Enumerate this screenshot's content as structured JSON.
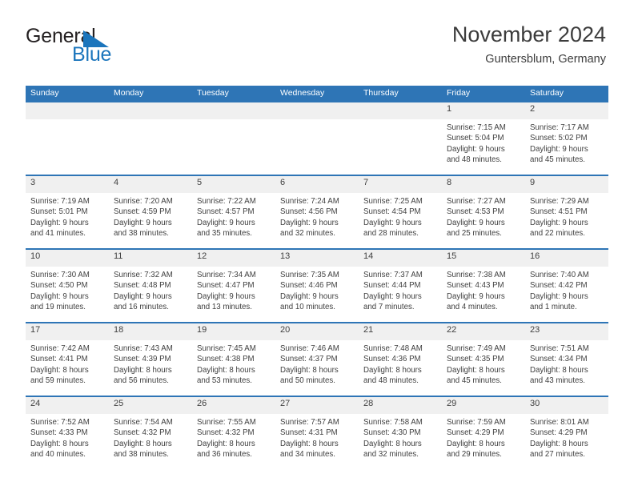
{
  "brand": {
    "word_one": "General",
    "word_two": "Blue",
    "triangle_icon": "triangle-icon",
    "accent_color": "#1b75bc"
  },
  "header": {
    "title": "November 2024",
    "subtitle": "Guntersblum, Germany"
  },
  "calendar": {
    "header_bg": "#2e75b6",
    "daynum_bg": "#f0f0f0",
    "weekdays": [
      "Sunday",
      "Monday",
      "Tuesday",
      "Wednesday",
      "Thursday",
      "Friday",
      "Saturday"
    ],
    "weeks": [
      [
        {
          "day": "",
          "lines": []
        },
        {
          "day": "",
          "lines": []
        },
        {
          "day": "",
          "lines": []
        },
        {
          "day": "",
          "lines": []
        },
        {
          "day": "",
          "lines": []
        },
        {
          "day": "1",
          "lines": [
            "Sunrise: 7:15 AM",
            "Sunset: 5:04 PM",
            "Daylight: 9 hours",
            "and 48 minutes."
          ]
        },
        {
          "day": "2",
          "lines": [
            "Sunrise: 7:17 AM",
            "Sunset: 5:02 PM",
            "Daylight: 9 hours",
            "and 45 minutes."
          ]
        }
      ],
      [
        {
          "day": "3",
          "lines": [
            "Sunrise: 7:19 AM",
            "Sunset: 5:01 PM",
            "Daylight: 9 hours",
            "and 41 minutes."
          ]
        },
        {
          "day": "4",
          "lines": [
            "Sunrise: 7:20 AM",
            "Sunset: 4:59 PM",
            "Daylight: 9 hours",
            "and 38 minutes."
          ]
        },
        {
          "day": "5",
          "lines": [
            "Sunrise: 7:22 AM",
            "Sunset: 4:57 PM",
            "Daylight: 9 hours",
            "and 35 minutes."
          ]
        },
        {
          "day": "6",
          "lines": [
            "Sunrise: 7:24 AM",
            "Sunset: 4:56 PM",
            "Daylight: 9 hours",
            "and 32 minutes."
          ]
        },
        {
          "day": "7",
          "lines": [
            "Sunrise: 7:25 AM",
            "Sunset: 4:54 PM",
            "Daylight: 9 hours",
            "and 28 minutes."
          ]
        },
        {
          "day": "8",
          "lines": [
            "Sunrise: 7:27 AM",
            "Sunset: 4:53 PM",
            "Daylight: 9 hours",
            "and 25 minutes."
          ]
        },
        {
          "day": "9",
          "lines": [
            "Sunrise: 7:29 AM",
            "Sunset: 4:51 PM",
            "Daylight: 9 hours",
            "and 22 minutes."
          ]
        }
      ],
      [
        {
          "day": "10",
          "lines": [
            "Sunrise: 7:30 AM",
            "Sunset: 4:50 PM",
            "Daylight: 9 hours",
            "and 19 minutes."
          ]
        },
        {
          "day": "11",
          "lines": [
            "Sunrise: 7:32 AM",
            "Sunset: 4:48 PM",
            "Daylight: 9 hours",
            "and 16 minutes."
          ]
        },
        {
          "day": "12",
          "lines": [
            "Sunrise: 7:34 AM",
            "Sunset: 4:47 PM",
            "Daylight: 9 hours",
            "and 13 minutes."
          ]
        },
        {
          "day": "13",
          "lines": [
            "Sunrise: 7:35 AM",
            "Sunset: 4:46 PM",
            "Daylight: 9 hours",
            "and 10 minutes."
          ]
        },
        {
          "day": "14",
          "lines": [
            "Sunrise: 7:37 AM",
            "Sunset: 4:44 PM",
            "Daylight: 9 hours",
            "and 7 minutes."
          ]
        },
        {
          "day": "15",
          "lines": [
            "Sunrise: 7:38 AM",
            "Sunset: 4:43 PM",
            "Daylight: 9 hours",
            "and 4 minutes."
          ]
        },
        {
          "day": "16",
          "lines": [
            "Sunrise: 7:40 AM",
            "Sunset: 4:42 PM",
            "Daylight: 9 hours",
            "and 1 minute."
          ]
        }
      ],
      [
        {
          "day": "17",
          "lines": [
            "Sunrise: 7:42 AM",
            "Sunset: 4:41 PM",
            "Daylight: 8 hours",
            "and 59 minutes."
          ]
        },
        {
          "day": "18",
          "lines": [
            "Sunrise: 7:43 AM",
            "Sunset: 4:39 PM",
            "Daylight: 8 hours",
            "and 56 minutes."
          ]
        },
        {
          "day": "19",
          "lines": [
            "Sunrise: 7:45 AM",
            "Sunset: 4:38 PM",
            "Daylight: 8 hours",
            "and 53 minutes."
          ]
        },
        {
          "day": "20",
          "lines": [
            "Sunrise: 7:46 AM",
            "Sunset: 4:37 PM",
            "Daylight: 8 hours",
            "and 50 minutes."
          ]
        },
        {
          "day": "21",
          "lines": [
            "Sunrise: 7:48 AM",
            "Sunset: 4:36 PM",
            "Daylight: 8 hours",
            "and 48 minutes."
          ]
        },
        {
          "day": "22",
          "lines": [
            "Sunrise: 7:49 AM",
            "Sunset: 4:35 PM",
            "Daylight: 8 hours",
            "and 45 minutes."
          ]
        },
        {
          "day": "23",
          "lines": [
            "Sunrise: 7:51 AM",
            "Sunset: 4:34 PM",
            "Daylight: 8 hours",
            "and 43 minutes."
          ]
        }
      ],
      [
        {
          "day": "24",
          "lines": [
            "Sunrise: 7:52 AM",
            "Sunset: 4:33 PM",
            "Daylight: 8 hours",
            "and 40 minutes."
          ]
        },
        {
          "day": "25",
          "lines": [
            "Sunrise: 7:54 AM",
            "Sunset: 4:32 PM",
            "Daylight: 8 hours",
            "and 38 minutes."
          ]
        },
        {
          "day": "26",
          "lines": [
            "Sunrise: 7:55 AM",
            "Sunset: 4:32 PM",
            "Daylight: 8 hours",
            "and 36 minutes."
          ]
        },
        {
          "day": "27",
          "lines": [
            "Sunrise: 7:57 AM",
            "Sunset: 4:31 PM",
            "Daylight: 8 hours",
            "and 34 minutes."
          ]
        },
        {
          "day": "28",
          "lines": [
            "Sunrise: 7:58 AM",
            "Sunset: 4:30 PM",
            "Daylight: 8 hours",
            "and 32 minutes."
          ]
        },
        {
          "day": "29",
          "lines": [
            "Sunrise: 7:59 AM",
            "Sunset: 4:29 PM",
            "Daylight: 8 hours",
            "and 29 minutes."
          ]
        },
        {
          "day": "30",
          "lines": [
            "Sunrise: 8:01 AM",
            "Sunset: 4:29 PM",
            "Daylight: 8 hours",
            "and 27 minutes."
          ]
        }
      ]
    ]
  }
}
